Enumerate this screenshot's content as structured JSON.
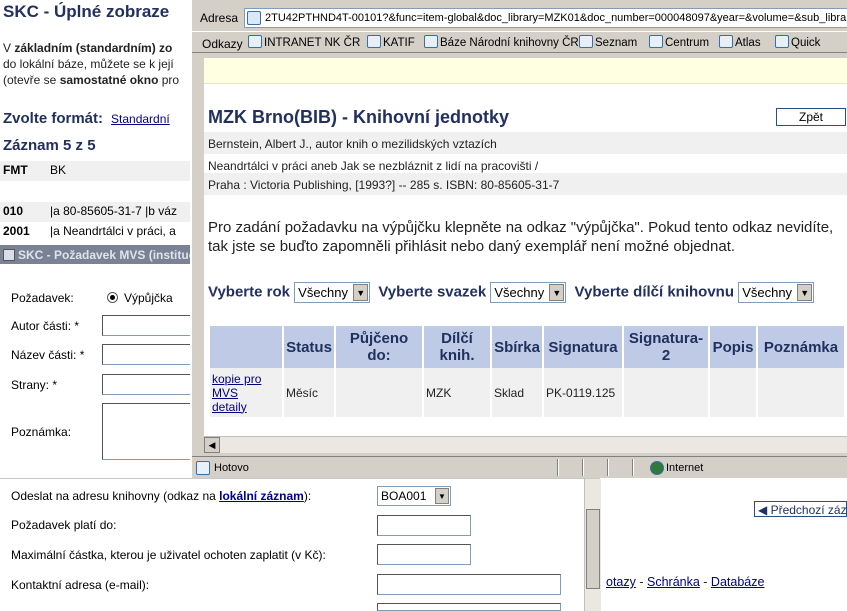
{
  "background": {
    "title": "SKC - Úplné zobraze",
    "intro_line1_a": "V ",
    "intro_line1_b": "základním (standardním) zo",
    "intro_line2": "do lokální báze, můžete se k její",
    "intro_line3_a": "(otevře se ",
    "intro_line3_b": "samostatné okno",
    "intro_line3_c": " pro",
    "format_label": "Zvolte formát:",
    "format_link": "Standardní",
    "record_label": "Záznam 5 z 5",
    "rows": [
      {
        "key": "FMT",
        "value": "BK"
      },
      {
        "key": "",
        "value": ""
      },
      {
        "key": "010",
        "value": "|a 80-85605-31-7 |b váz"
      },
      {
        "key": "2001",
        "value": "|a Neandrtálci v práci, a"
      }
    ]
  },
  "mvs_form": {
    "titlebar": "SKC - Požadavek MVS (institucí",
    "request_label": "Požadavek:",
    "request_option": "Výpůjčka",
    "author_label": "Autor části: *",
    "part_name_label": "Název části: *",
    "pages_label": "Strany: *",
    "note_label": "Poznámka:",
    "send_to_label_a": "Odeslat na adresu knihovny (odkaz na ",
    "send_to_link": "lokální záznam",
    "send_to_label_b": "):",
    "send_to_value": "BOA001",
    "valid_until_label": "Požadavek platí do:",
    "max_amount_label": "Maximální částka, kterou je uživatel ochoten zaplatit (v Kč):",
    "contact_label": "Kontaktní adresa (e-mail):"
  },
  "popup": {
    "address_label": "Adresa",
    "url": "2TU42PTHND4T-00101?&func=item-global&doc_library=MZK01&doc_number=000048097&year=&volume=&sub_library=",
    "links_label": "Odkazy",
    "links": [
      "INTRANET NK ČR",
      "KATIF",
      "Báze Národní knihovny ČR",
      "Seznam",
      "Centrum",
      "Atlas",
      "Quick"
    ],
    "page_title": "MZK Brno(BIB) - Knihovní jednotky",
    "back_button": "Zpět",
    "bib_lines": [
      "Bernstein, Albert J., autor knih o mezilidských vztazích",
      "Neandrtálci v práci aneb Jak se nezbláznit z lidí na pracovišti /",
      "Praha : Victoria Publishing, [1993?] -- 285 s. ISBN: 80-85605-31-7"
    ],
    "info_line1": "Pro zadání požadavku na výpůjčku klepněte na odkaz \"výpůjčka\". Pokud tento odkaz nevidíte,",
    "info_line2": "tak jste se buďto zapomněli přihlásit nebo daný exemplář není možné objednat.",
    "filter_year_label": "Vyberte rok",
    "filter_year_value": "Všechny",
    "filter_volume_label": "Vyberte svazek",
    "filter_volume_value": "Všechny",
    "filter_sublib_label": "Vyberte dílčí knihovnu",
    "filter_sublib_value": "Všechny",
    "table_headers": [
      "",
      "Status",
      "Půjčeno do:",
      "Dílčí knih.",
      "Sbírka",
      "Signatura",
      "Signatura-2",
      "Popis",
      "Poznámka"
    ],
    "row": {
      "link1": "kopie pro",
      "link2": "MVS",
      "link3": "detaily",
      "status": "Měsíc",
      "loaned": "",
      "sublib": "MZK",
      "collection": "Sklad",
      "signature": "PK-0119.125",
      "signature2": "",
      "description": "",
      "note": ""
    },
    "status_text": "Hotovo",
    "zone_text": "Internet"
  },
  "bottom_right": {
    "prev_button": "◀ Předchozí zázn",
    "link_a": "otazy",
    "sep1": " - ",
    "link_b": "Schránka",
    "sep2": " - ",
    "link_c": "Databáze"
  }
}
